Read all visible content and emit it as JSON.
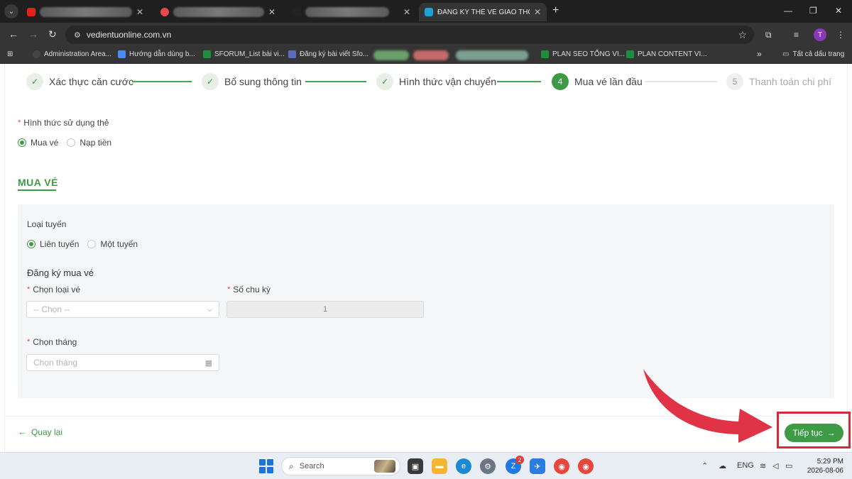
{
  "browser": {
    "active_tab_title": "ĐĂNG KÝ THẺ VÉ GIAO THÔNG",
    "url": "vedientuonline.com.vn",
    "profile_initial": "T",
    "bookmarks": [
      {
        "label": "Administration Area..."
      },
      {
        "label": "Hướng dẫn dùng b..."
      },
      {
        "label": "SFORUM_List bài vi..."
      },
      {
        "label": "Đăng ký bài viết Sfo..."
      },
      {
        "label": "PLAN SEO TỔNG VI..."
      },
      {
        "label": "PLAN CONTENT VI..."
      }
    ],
    "bookmarks_overflow": "»",
    "all_bookmarks": "Tất cả dấu trang"
  },
  "stepper": {
    "steps": [
      {
        "label": "Xác thực căn cước",
        "status": "done"
      },
      {
        "label": "Bổ sung thông tin",
        "status": "done"
      },
      {
        "label": "Hình thức vận chuyển",
        "status": "done"
      },
      {
        "label": "Mua vé lần đầu",
        "status": "current",
        "number": "4"
      },
      {
        "label": "Thanh toán chi phí",
        "status": "todo",
        "number": "5"
      }
    ]
  },
  "form": {
    "usage_label": "Hình thức sử dụng thẻ",
    "usage_options": [
      "Mua vé",
      "Nạp tiền"
    ],
    "usage_selected": "Mua vé",
    "section_title": "MUA VÉ",
    "route_label": "Loại tuyến",
    "route_options": [
      "Liên tuyến",
      "Một tuyến"
    ],
    "route_selected": "Liên tuyến",
    "register_heading": "Đăng ký mua vé",
    "ticket_type_label": "Chọn loại vé",
    "ticket_type_placeholder": "-- Chọn --",
    "cycles_label": "Số chu kỳ",
    "cycles_value": "1",
    "month_label": "Chọn tháng",
    "month_placeholder": "Chọn tháng"
  },
  "footer": {
    "back_label": "Quay lại",
    "next_label": "Tiếp tục"
  },
  "taskbar": {
    "search_label": "Search",
    "zalo_badge": "2",
    "language": "ENG",
    "time": "5:29 PM",
    "date": "2026-08-06"
  },
  "colors": {
    "accent": "#3e9a45",
    "highlight": "#d42a3a"
  }
}
